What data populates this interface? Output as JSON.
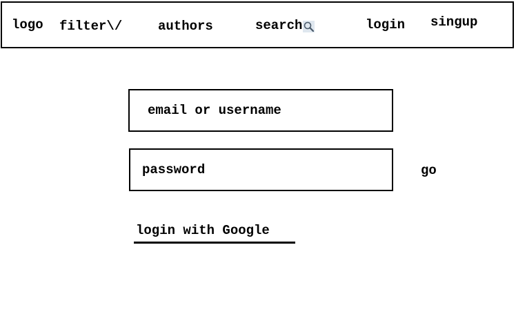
{
  "navbar": {
    "logo": "logo",
    "filter": "filter\\/",
    "authors": "authors",
    "search": "search",
    "search_icon": "magnifier-icon",
    "login": "login",
    "signup": "singup"
  },
  "form": {
    "email_placeholder": "email or username",
    "password_placeholder": "password",
    "go_label": "go",
    "google_label": "login with Google"
  },
  "colors": {
    "background": "#ffffff",
    "ink": "#000000",
    "icon_bg": "#dfe7ef"
  }
}
